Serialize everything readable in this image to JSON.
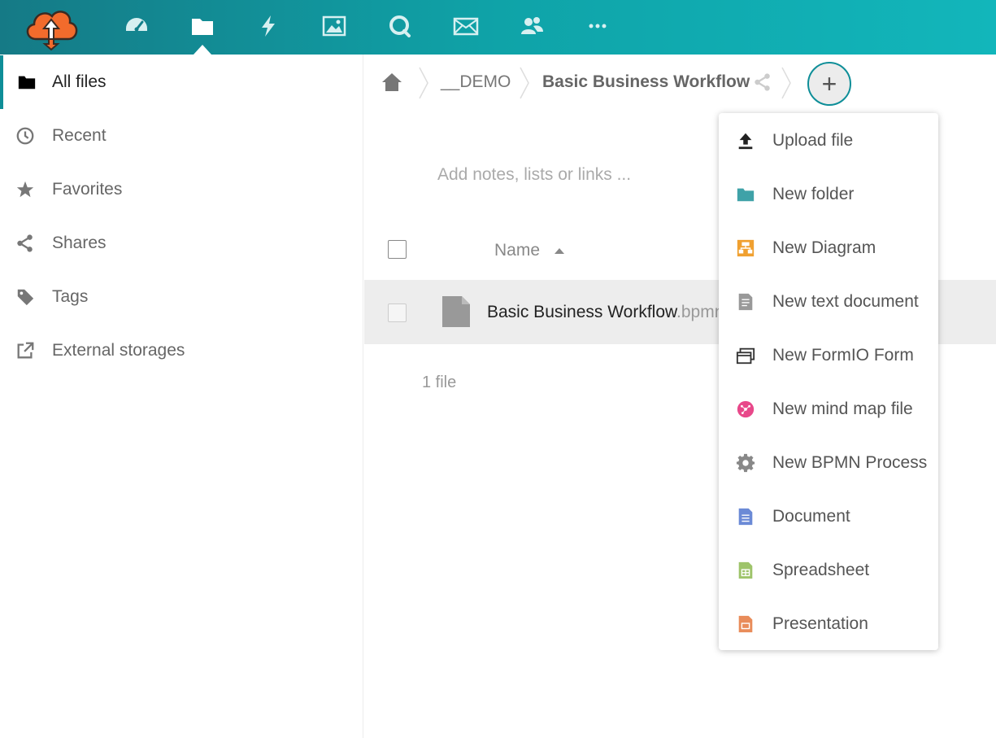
{
  "header": {
    "nav_icons": [
      "dashboard-icon",
      "files-icon",
      "activity-icon",
      "photos-icon",
      "search-icon",
      "mail-icon",
      "contacts-icon",
      "more-apps-icon"
    ],
    "active_nav": "files",
    "colors": {
      "bg_start": "#157a86",
      "bg_end": "#12b6bb",
      "logo_orange": "#f26b2c"
    }
  },
  "sidebar": {
    "items": [
      {
        "label": "All files",
        "icon": "folder-icon",
        "active": true
      },
      {
        "label": "Recent",
        "icon": "clock-icon",
        "active": false
      },
      {
        "label": "Favorites",
        "icon": "star-icon",
        "active": false
      },
      {
        "label": "Shares",
        "icon": "share-icon",
        "active": false
      },
      {
        "label": "Tags",
        "icon": "tag-icon",
        "active": false
      },
      {
        "label": "External storages",
        "icon": "external-link-icon",
        "active": false
      }
    ]
  },
  "breadcrumb": {
    "items": [
      "__DEMO",
      "Basic Business Workflow"
    ],
    "add_button_label": "+"
  },
  "notes_placeholder": "Add notes, lists or links ...",
  "table": {
    "name_header": "Name",
    "rows": [
      {
        "name": "Basic Business Workflow",
        "ext": ".bpmn"
      }
    ],
    "summary": "1 file"
  },
  "new_menu": {
    "items": [
      {
        "label": "Upload file",
        "icon": "upload-icon"
      },
      {
        "label": "New folder",
        "icon": "folder-icon"
      },
      {
        "label": "New Diagram",
        "icon": "diagram-icon"
      },
      {
        "label": "New text document",
        "icon": "text-document-icon"
      },
      {
        "label": "New FormIO Form",
        "icon": "form-icon"
      },
      {
        "label": "New mind map file",
        "icon": "mind-map-icon"
      },
      {
        "label": "New BPMN Process",
        "icon": "gear-icon"
      },
      {
        "label": "Document",
        "icon": "document-icon"
      },
      {
        "label": "Spreadsheet",
        "icon": "spreadsheet-icon"
      },
      {
        "label": "Presentation",
        "icon": "presentation-icon"
      }
    ]
  }
}
